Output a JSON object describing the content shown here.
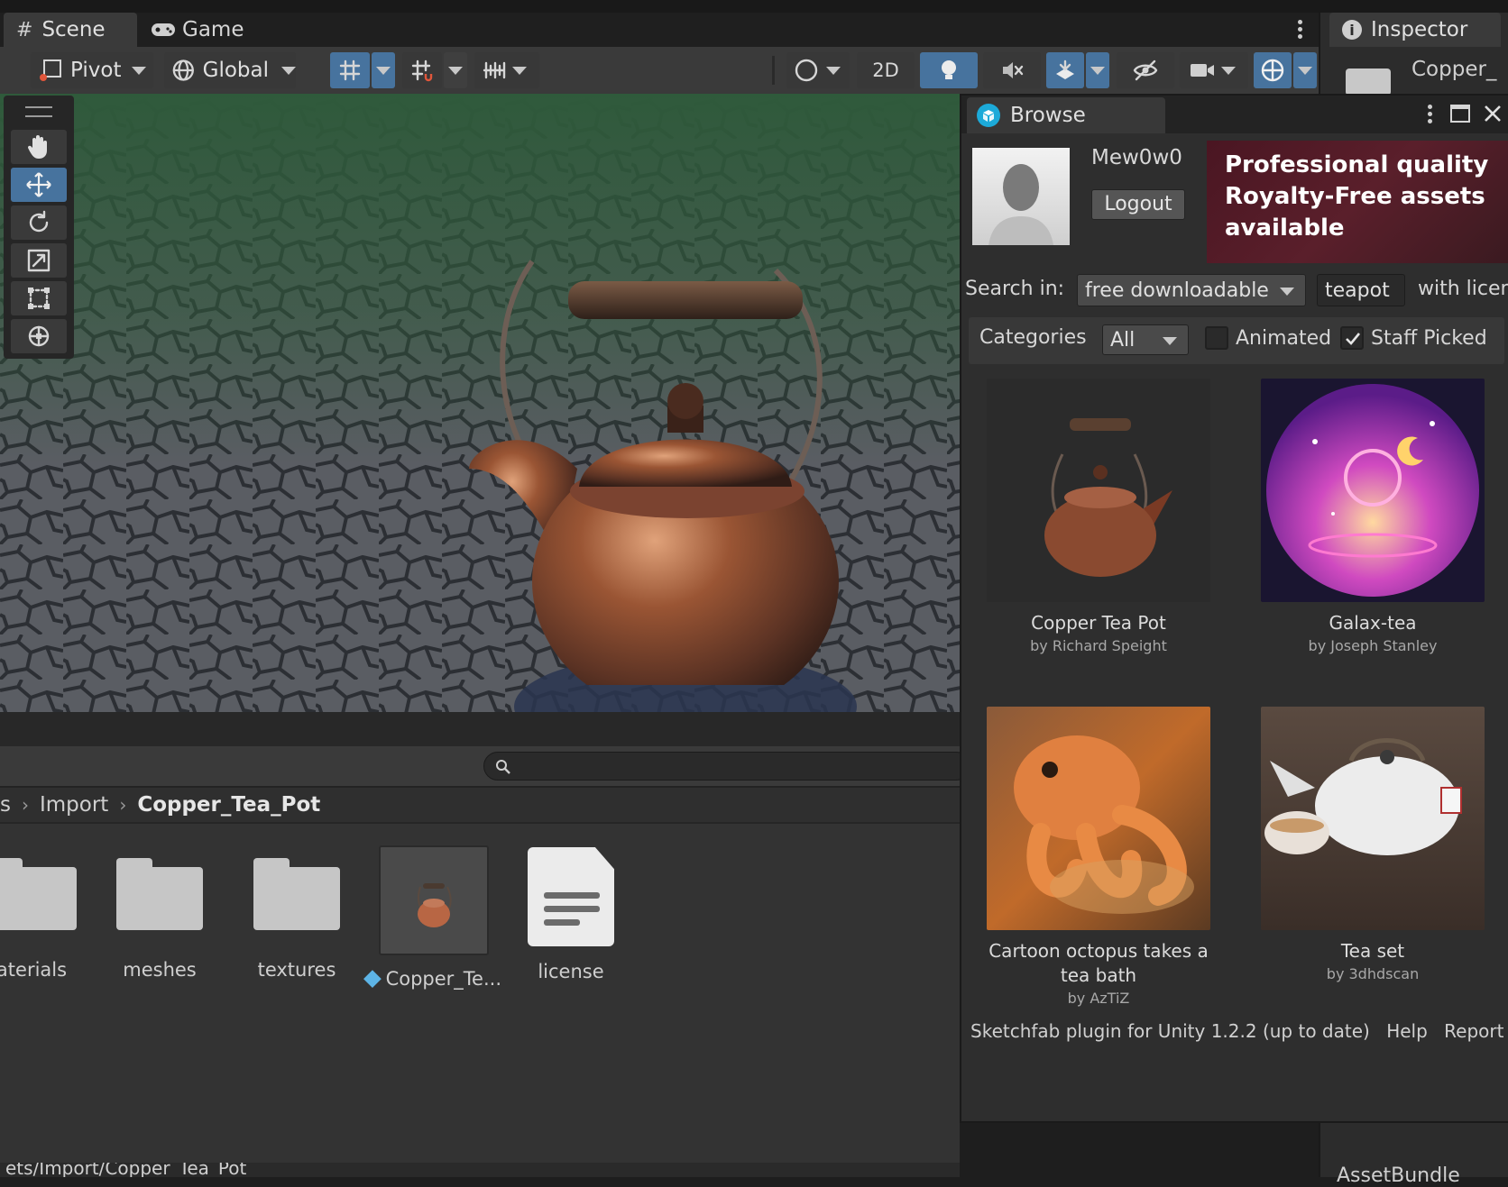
{
  "scene_tabs": {
    "scene": "Scene",
    "game": "Game"
  },
  "inspector": {
    "tab": "Inspector",
    "object_name": "Copper_",
    "bottom_label": "AssetBundle"
  },
  "toolbar": {
    "pivot": "Pivot",
    "global": "Global",
    "mode_2d": "2D"
  },
  "browse": {
    "title": "Browse",
    "username": "Mew0w0",
    "logout": "Logout",
    "banner_text": [
      "Professional quality",
      "Royalty-Free assets",
      "available"
    ],
    "search_in_label": "Search in:",
    "search_scope": "free downloadable",
    "query": "teapot",
    "license_label": "with licen",
    "categories_label": "Categories",
    "category": "All",
    "animated_label": "Animated",
    "animated_checked": false,
    "staff_picked_label": "Staff Picked",
    "staff_picked_checked": true,
    "results": [
      {
        "title": "Copper Tea Pot",
        "author": "by Richard Speight"
      },
      {
        "title": "Galax-tea",
        "author": "by Joseph Stanley"
      },
      {
        "title": "Cartoon octopus takes a tea bath",
        "author": "by AzTiZ"
      },
      {
        "title": "Tea set",
        "author": "by 3dhdscan"
      }
    ],
    "footer_version": "Sketchfab plugin for Unity 1.2.2 (up to date)",
    "footer_help": "Help",
    "footer_report": "Report an i"
  },
  "project": {
    "breadcrumb": {
      "partial": "s",
      "import": "Import",
      "current": "Copper_Tea_Pot"
    },
    "assets": [
      {
        "name": "aterials",
        "kind": "folder"
      },
      {
        "name": "meshes",
        "kind": "folder"
      },
      {
        "name": "textures",
        "kind": "folder"
      },
      {
        "name": "Copper_Te...",
        "kind": "prefab"
      },
      {
        "name": "license",
        "kind": "text"
      }
    ],
    "path": "ets/Import/Copper_Tea_Pot"
  },
  "colors": {
    "accent": "#47739e",
    "panel": "#383838",
    "window": "#2b2b2b"
  }
}
